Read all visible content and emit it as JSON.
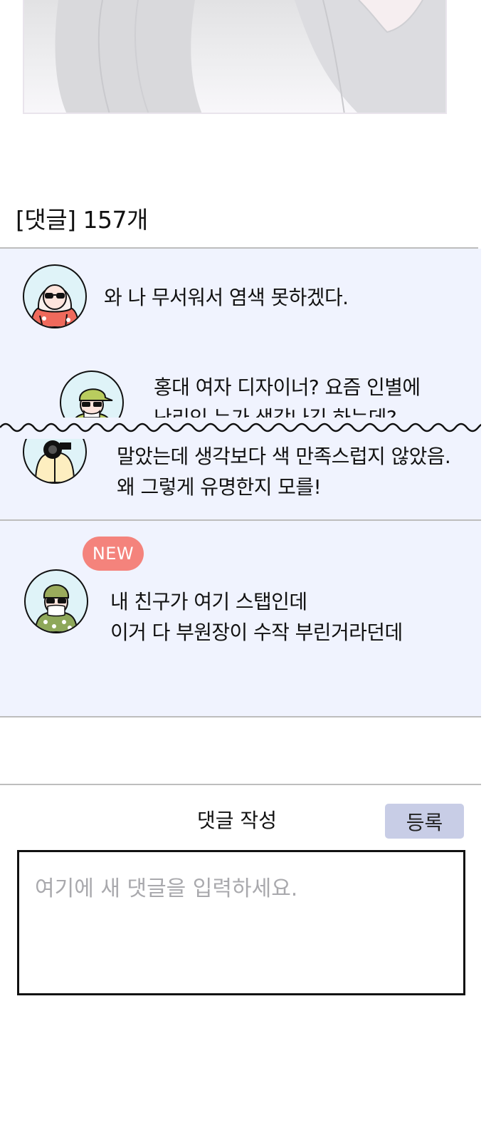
{
  "comments_section": {
    "count_label": "[댓글] 157개",
    "threads": [
      {
        "avatar": "avatar-hooded-sunglasses",
        "text_lines": [
          "와 나 무서워서 염색 못하겠다."
        ],
        "reply": {
          "avatar": "avatar-cap-sunglasses",
          "text_lines": [
            "홍대 여자 디자이너? 요즘 인별에",
            "난리인 누가 생각나긴 하는데?"
          ]
        },
        "cut_reply": {
          "avatar": "avatar-camera",
          "text_lines": [
            "말았는데 생각보다 색 만족스럽지 않았음.",
            "왜 그렇게 유명한지 모를!"
          ]
        }
      },
      {
        "badge": "NEW",
        "avatar": "avatar-beanie-mask",
        "text_lines": [
          "내 친구가 여기 스탭인데",
          "이거 다 부원장이 수작 부린거라던데"
        ]
      }
    ]
  },
  "compose": {
    "title": "댓글 작성",
    "submit_label": "등록",
    "placeholder": "여기에 새 댓글을 입력하세요."
  },
  "colors": {
    "thread_bg": "#f0f3fe",
    "new_badge": "#f4837c",
    "submit_button": "#c8cde6"
  }
}
